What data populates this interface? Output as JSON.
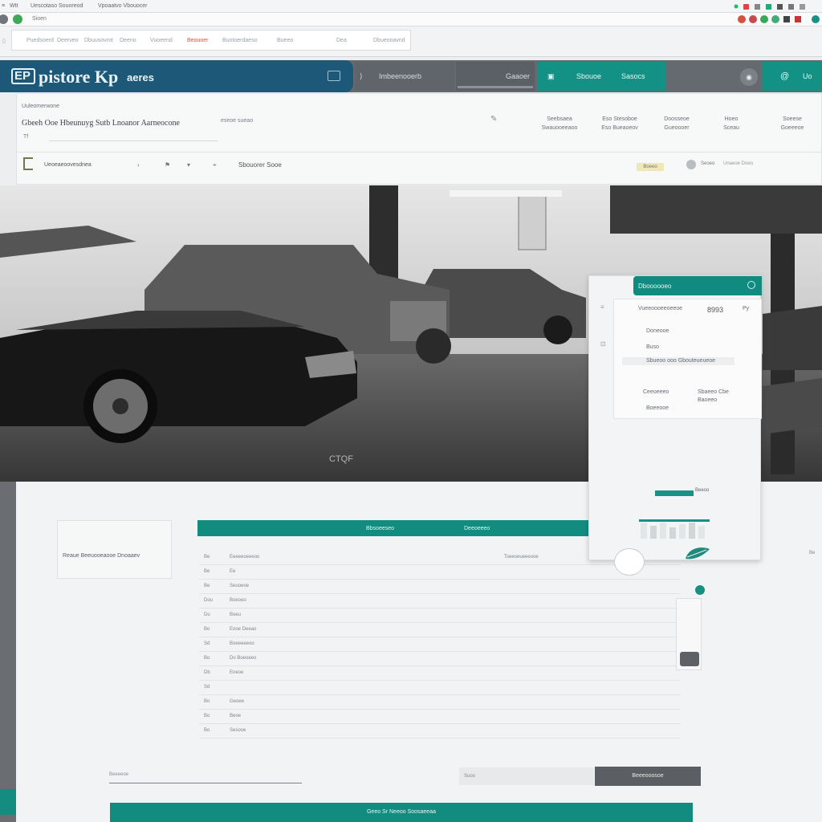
{
  "browser": {
    "tab_left": "Wtt",
    "tab_title": "Uescotaso Souoreod",
    "tab_second": "Vpoaatvo Vbouocer",
    "url": "Sioen",
    "bookmarks": [
      "Puedsoerd",
      "Deerveo",
      "Dbuusovrot",
      "Deeno",
      "Vuoeend",
      "Beouoer",
      "Buotoerdaeso",
      "Bueeo",
      "Dea",
      "Dbueooavnd"
    ]
  },
  "nav": {
    "brand_badge": "EP",
    "brand_name": "pistore Kp",
    "brand_sub": "aeres",
    "items": [
      "Imbeenooerb",
      "Gaaoer",
      "Sbouoe",
      "Sasocs"
    ],
    "teal_right": "Uo",
    "avatar": "@"
  },
  "toolbar": {
    "caption": "Uuleomerwone",
    "heading": "Gbeeh Ooe Hbeunuyg Sutb Lnoanor Aarneocone",
    "heading_small": "eseoe\nsueao",
    "sub_caption": "Tf",
    "columns": [
      {
        "l1": "Seebsaea",
        "l2": "Swauooeeaoo"
      },
      {
        "l1": "Eso Stesoboe",
        "l2": "Eso Bueaoeov"
      },
      {
        "l1": "Doosseoe",
        "l2": "Gueoooer"
      },
      {
        "l1": "Hoeo",
        "l2": "Sceau"
      },
      {
        "l1": "Soeese",
        "l2": "Goeeeoe"
      }
    ],
    "row2_label": "Ueoeaeoovesdnea",
    "row2_icons_label": "Sbouorer Sooe",
    "badge": "Boeeo",
    "row2_right": "Seoeo",
    "row2_far": "Unaeoe Doeo"
  },
  "hero": {
    "watermark": "CTQF"
  },
  "card": {
    "header": "Dboooooeo",
    "price": "8993",
    "price_sub": "Py",
    "line1": "Vueeoooeeoeeoe",
    "line2": "Doneooe",
    "line3": "Buso",
    "line4": "Sbueoo ooo Gbouteueueoe",
    "col1_top": "Ceeoeeeo",
    "col1_bottom": "Boeeooe",
    "col2_top": "Sbaeeo Cbe",
    "col2_bottom": "Baoeeo"
  },
  "lower": {
    "label_box": "Reaue Beeuooeaooe Dnoaaev",
    "teal_left": "Bbsoeeseo",
    "teal_right": "Deeoeeeo",
    "progress_label": "Beeoo",
    "table_rows": [
      {
        "num": "Be",
        "text": "Eeeeeoeeeoo",
        "right": "Tseeoeueeeooe"
      },
      {
        "num": "Be",
        "text": "Ee",
        "right": ""
      },
      {
        "num": "Be",
        "text": "Seuoeoe",
        "right": ""
      },
      {
        "num": "Dou",
        "text": "Boeoeo",
        "right": ""
      },
      {
        "num": "Du",
        "text": "Boeu",
        "right": ""
      },
      {
        "num": "Bo",
        "text": "Eooe Deeao",
        "right": ""
      },
      {
        "num": "Sd",
        "text": "Boeeeeeoo",
        "right": ""
      },
      {
        "num": "Bo",
        "text": "Do Boeoeeo",
        "right": ""
      },
      {
        "num": "Db",
        "text": "Eneoe",
        "right": ""
      },
      {
        "num": "Sd",
        "text": "",
        "right": ""
      },
      {
        "num": "Bo",
        "text": "Geoee",
        "right": ""
      },
      {
        "num": "Bo",
        "text": "Beoe",
        "right": ""
      },
      {
        "num": "Bo",
        "text": "Sesooe",
        "right": ""
      }
    ],
    "input_label": "Beeeeoe",
    "input_gray": "Suoo",
    "dark_button": "Beeeooosoe",
    "bottom_button": "Geeo Sr Neeoo Soosaeeaa",
    "right_tag": "Be"
  },
  "colors": {
    "teal": "#138c80",
    "brand_blue": "#1d5878",
    "nav_gray": "#646a70",
    "dark_button": "#5b5e62"
  }
}
